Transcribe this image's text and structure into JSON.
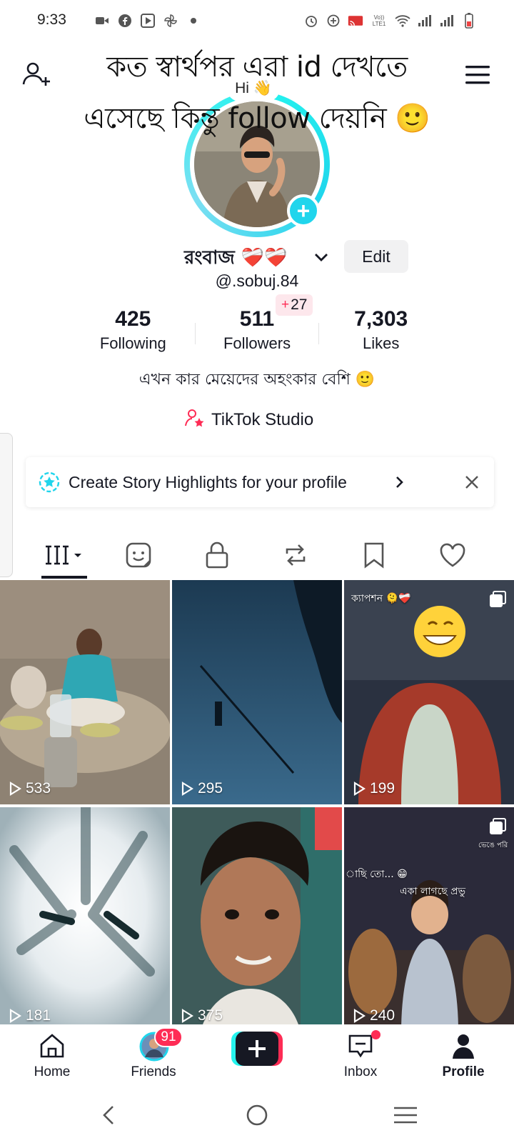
{
  "status_bar": {
    "time": "9:33",
    "left_icons": [
      "video-icon",
      "facebook-icon",
      "play-store-icon",
      "pinwheel-icon",
      "dot-icon"
    ],
    "right_icons": [
      "alarm-icon",
      "data-saver-icon",
      "cast-icon",
      "volte-icon",
      "wifi-icon",
      "signal-icon",
      "signal-icon",
      "battery-icon"
    ],
    "volte_text": "Vo)) LTE1"
  },
  "header": {
    "caption_line1": "কত স্বার্থপর এরা id দেখতে",
    "caption_line2": "এসেছে কিন্তু follow দেয়নি 🙂",
    "hi_text": "Hi 👋"
  },
  "profile": {
    "display_name": "রংবাজ ❤️‍🩹❤️‍🩹",
    "edit_label": "Edit",
    "username": "@.sobuj.84",
    "follower_delta_sign": "+",
    "follower_delta": "27",
    "stats": [
      {
        "value": "425",
        "label": "Following"
      },
      {
        "value": "511",
        "label": "Followers"
      },
      {
        "value": "7,303",
        "label": "Likes"
      }
    ],
    "bio": "এখন কার মেয়েদের অহংকার বেশি 🙂",
    "studio_label": "TikTok Studio"
  },
  "highlights_banner": {
    "text": "Create Story Highlights for your profile"
  },
  "tabs": [
    "videos-grid-icon",
    "tagged-icon",
    "lock-icon",
    "repost-icon",
    "bookmark-icon",
    "heart-icon"
  ],
  "videos": [
    {
      "views": "533"
    },
    {
      "views": "295"
    },
    {
      "views": "199",
      "caption": "ক্যাপশন 🫠❤️‍🩹"
    },
    {
      "views": "181"
    },
    {
      "views": "375"
    },
    {
      "views": "240",
      "caption_a": "াছি তো... 😁",
      "caption_b": "একা লাগছে প্রভু",
      "caption_c": "ভেঙে পরি"
    }
  ],
  "bottom_nav": {
    "home": "Home",
    "friends": "Friends",
    "friends_badge": "91",
    "create": "+",
    "inbox": "Inbox",
    "profile": "Profile"
  },
  "colors": {
    "accent_red": "#fe2c55",
    "accent_cyan": "#20d5ec",
    "text": "#161823"
  }
}
